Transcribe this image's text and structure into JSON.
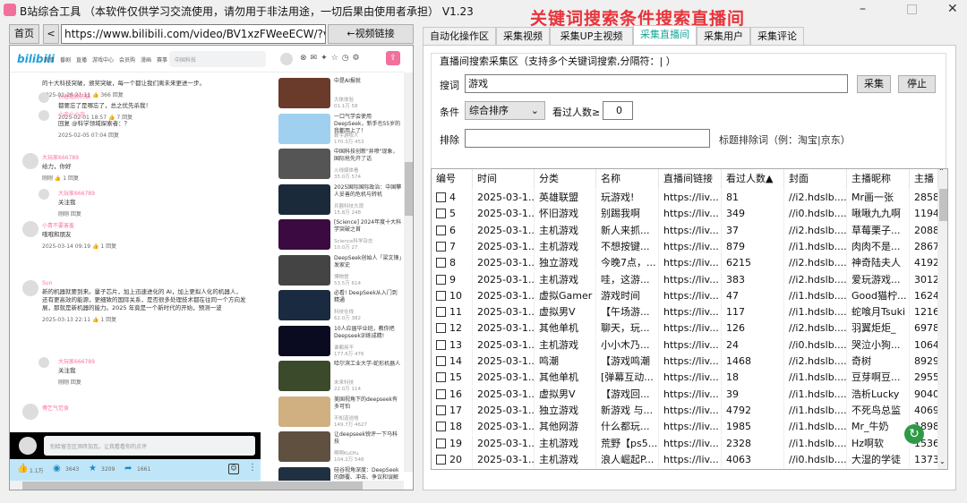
{
  "app": {
    "title": "B站综合工具 （本软件仅供学习交流使用，请勿用于非法用途，一切后果由使用者承担） V1.23",
    "overlay_caption": "关键词搜索条件搜索直播间",
    "minimize": "–",
    "maximize": "□",
    "close": "✕"
  },
  "browser_bar": {
    "home": "首页",
    "back": "<",
    "url": "https://www.bilibili.com/video/BV1xzFWeeECW/?vd_source",
    "go": "←视频链接"
  },
  "bili": {
    "logo": "bilibili",
    "nav": [
      "首页",
      "番剧",
      "直播",
      "游戏中心",
      "会员购",
      "漫画",
      "赛事"
    ],
    "search_placeholder": "中国科技",
    "comments": [
      {
        "text": "的十大科技突破，颁奖突破，每一个都让我们离未来更进一步。",
        "meta": "2025-01-28 21:11   👍 366   回复"
      },
      {
        "user": "长着翅膀的猫",
        "text": "都要忘了是哪忘了，总之优先杀我！",
        "meta": "2025-02-01 18:57   👍 7   回复"
      },
      {
        "user": "小农小小农",
        "text": "回复 @科学领域探索者：？",
        "meta": "2025-02-05 07:04   回复"
      },
      {
        "user": "大玩家666789",
        "text": "给力，你好",
        "meta": "刚刚   👍 1   回复"
      },
      {
        "user": "大玩家666789",
        "text": "关注我",
        "meta": "刚刚   回复"
      },
      {
        "user": "小青不要害羞",
        "text": "哦哦和朋友",
        "meta": "2025-03-14 09:19   👍 1   回复"
      },
      {
        "user": "Sun",
        "text": "新的机器就要到来。量子芯片，加上迅速进化的 AI，加上更拟人化的机器人，还有更高效的能源，更细致的国际关系，是否很多处理技术都在往同一个方向发展，那就是新机器的能力。2025 年竟是一个新时代的开始，预测一波",
        "meta": "2025-03-13 22:11   👍 1   回复"
      },
      {
        "user": "大玩家666789",
        "text": "关注我",
        "meta": "刚刚   回复"
      },
      {
        "user": "傅乞气范食",
        "text": ""
      }
    ],
    "comment_placeholder": "别给留言区添砖加瓦，让我看看你的点评",
    "actions": [
      {
        "icon": "thumb-up",
        "count": "1.1万"
      },
      {
        "icon": "coin",
        "count": "3643"
      },
      {
        "icon": "star",
        "count": "3209"
      },
      {
        "icon": "share",
        "count": "1661"
      }
    ],
    "videos": [
      {
        "title": "中是AI报就",
        "author": "大体体验",
        "stats": "01.1万  58"
      },
      {
        "title": "一口气学会使用DeepSeek，新手也55岁的我都用上了！",
        "author": "数字游牧人",
        "stats": "170.3万  453"
      },
      {
        "title": "中国科技创新\"井喷\"现象，国际抢先开了话",
        "author": "火线媒体看",
        "stats": "35.0万  574"
      },
      {
        "title": "2025国际国际政治：中国攀人妥善的危机与转机",
        "author": "兵器科技大观",
        "stats": "15.8万  248"
      },
      {
        "title": "[Science] 2024年度十大科学突破之首",
        "author": "Science科学杂志",
        "stats": "10.0万  27"
      },
      {
        "title": "DeepSeek创始人「梁文锋」发家史",
        "author": "博物馆",
        "stats": "53.5万  614"
      },
      {
        "title": "必看! DeepSeek从入门到精通",
        "author": "科技在线",
        "stats": "62.0万  382"
      },
      {
        "title": "10人应届毕业班，教你把Deepseek训练成精!",
        "author": "谁都用不",
        "stats": "177.6万  476"
      },
      {
        "title": "哈尔滨工业大学-蛇形机器人",
        "author": "未来科技",
        "stats": "22.0万  114"
      },
      {
        "title": "美国视角下的deepseek有多可怕",
        "author": "不知道说啥",
        "stats": "149.7万  4627"
      },
      {
        "title": "让deepseek锐评一下马科技",
        "author": "啊啊KuOfu",
        "stats": "104.2万  548"
      },
      {
        "title": "硅谷视角深度：DeepSeek的颠覆、冲击、争议和误解",
        "author": "",
        "stats": ""
      }
    ]
  },
  "tabs": [
    {
      "label": "自动化操作区"
    },
    {
      "label": "采集视频"
    },
    {
      "label": "采集UP主视频"
    },
    {
      "label": "采集直播间",
      "active": true
    },
    {
      "label": "采集用户"
    },
    {
      "label": "采集评论"
    }
  ],
  "form": {
    "group_title": "直播间搜索采集区（支持多个关键词搜索,分隔符：| ）",
    "keyword_label": "搜词",
    "keyword_value": "游戏",
    "collect": "采集",
    "stop": "停止",
    "condition_label": "条件",
    "condition_value": "综合排序",
    "viewers_label": "看过人数≥",
    "viewers_value": "0",
    "exclude_label": "排除",
    "exclude_value": "",
    "exclude_hint": "标题排除词（例：淘宝|京东）"
  },
  "table": {
    "columns": [
      "编号",
      "时间",
      "分类",
      "名称",
      "直播间链接",
      "看过人数▲",
      "封面",
      "主播昵称",
      "主播"
    ],
    "rows": [
      [
        "4",
        "2025-03-1...",
        "英雄联盟",
        "玩游戏!",
        "https://liv...",
        "81",
        "//i2.hdslb....",
        "Mr画一张",
        "2858"
      ],
      [
        "5",
        "2025-03-1...",
        "怀旧游戏",
        "别踢我啊",
        "https://liv...",
        "349",
        "//i0.hdslb....",
        "啾啾九九啊",
        "1194"
      ],
      [
        "6",
        "2025-03-1...",
        "主机游戏",
        "新人来抓...",
        "https://liv...",
        "37",
        "//i2.hdslb....",
        "草莓栗子...",
        "2088"
      ],
      [
        "7",
        "2025-03-1...",
        "主机游戏",
        "不想按键...",
        "https://liv...",
        "879",
        "//i1.hdslb....",
        "肉肉不是...",
        "2867"
      ],
      [
        "8",
        "2025-03-1...",
        "独立游戏",
        "今晚7点，...",
        "https://liv...",
        "6215",
        "//i2.hdslb....",
        "神奇陆夫人",
        "4192"
      ],
      [
        "9",
        "2025-03-1...",
        "主机游戏",
        "哇，这游...",
        "https://liv...",
        "383",
        "//i2.hdslb....",
        "爱玩游戏...",
        "3012"
      ],
      [
        "10",
        "2025-03-1...",
        "虚拟Gamer",
        "游戏时间",
        "https://liv...",
        "47",
        "//i1.hdslb....",
        "Good猫柠...",
        "1624"
      ],
      [
        "11",
        "2025-03-1...",
        "虚拟男V",
        "【午场游...",
        "https://liv...",
        "117",
        "//i1.hdslb....",
        "蛇喰月Tsuki",
        "1216"
      ],
      [
        "12",
        "2025-03-1...",
        "其他单机",
        "聊天，玩...",
        "https://liv...",
        "126",
        "//i2.hdslb....",
        "羽翼炬炬_",
        "6978"
      ],
      [
        "13",
        "2025-03-1...",
        "主机游戏",
        "小小木乃...",
        "https://liv...",
        "24",
        "//i0.hdslb....",
        "哭泣小狗...",
        "1064"
      ],
      [
        "14",
        "2025-03-1...",
        "鸣潮",
        "【游戏鸣潮",
        "https://liv...",
        "1468",
        "//i2.hdslb....",
        "奇树",
        "8929"
      ],
      [
        "15",
        "2025-03-1...",
        "其他单机",
        "[弹幕互动...",
        "https://liv...",
        "18",
        "//i1.hdslb....",
        "豆芽啊豆...",
        "2955"
      ],
      [
        "16",
        "2025-03-1...",
        "虚拟男V",
        "【游戏回...",
        "https://liv...",
        "39",
        "//i1.hdslb....",
        "浩析Lucky",
        "9040"
      ],
      [
        "17",
        "2025-03-1...",
        "独立游戏",
        "新游戏 与...",
        "https://liv...",
        "4792",
        "//i1.hdslb....",
        "不死鸟总监",
        "4069"
      ],
      [
        "18",
        "2025-03-1...",
        "其他网游",
        "什么都玩...",
        "https://liv...",
        "1985",
        "//i1.hdslb....",
        "Mr_牛奶",
        "1898"
      ],
      [
        "19",
        "2025-03-1...",
        "主机游戏",
        "荒野【ps5...",
        "https://liv...",
        "2328",
        "//i1.hdslb....",
        "Hz啊软",
        "1536"
      ],
      [
        "20",
        "2025-03-1...",
        "主机游戏",
        "浪人崛起P...",
        "https://liv...",
        "4063",
        "//i0.hdslb....",
        "大湿的学徒",
        "1373"
      ]
    ]
  },
  "colors": {
    "accent": "#1aa69a",
    "overlay": "#e8333a",
    "bili_pink": "#f36f9c",
    "bili_blue": "#20a0d8",
    "action_bar": "#bfe6f8"
  }
}
